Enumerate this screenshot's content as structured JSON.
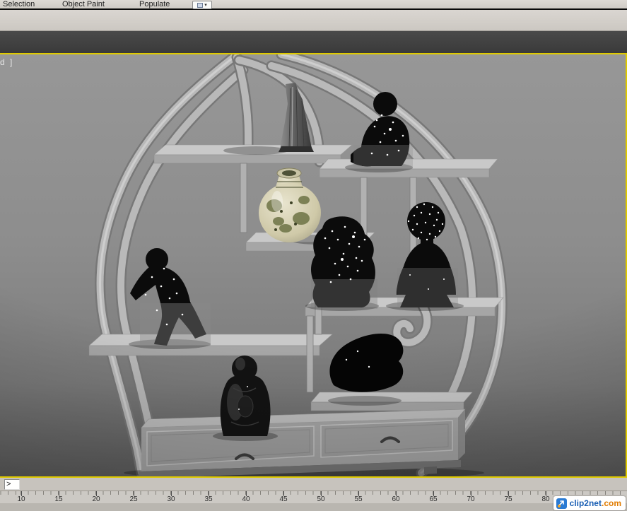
{
  "ribbon": {
    "tabs": [
      {
        "label": "Selection"
      },
      {
        "label": "Object Paint"
      },
      {
        "label": "Populate"
      }
    ],
    "overflow_chevron": "▾"
  },
  "viewport": {
    "label_fragment": "d ]",
    "border_color": "#dfca00"
  },
  "maxscript_listener": {
    "prompt": ">"
  },
  "timeline": {
    "ticks": [
      "10",
      "15",
      "20",
      "25",
      "30",
      "35",
      "40",
      "45",
      "50",
      "55",
      "60",
      "65",
      "70",
      "75",
      "80"
    ]
  },
  "watermark": {
    "brand": "clip2net",
    "domain": ".com"
  }
}
